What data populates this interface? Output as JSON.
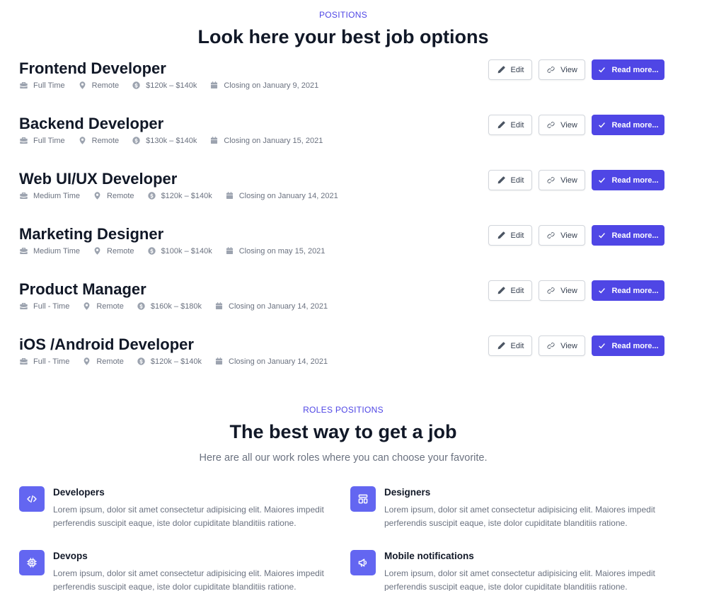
{
  "positions": {
    "eyebrow": "POSITIONS",
    "heading": "Look here your best job options",
    "buttons": {
      "edit": "Edit",
      "view": "View",
      "read_more": "Read more..."
    },
    "jobs": [
      {
        "title": "Frontend Developer",
        "type": "Full Time",
        "location": "Remote",
        "salary": "$120k – $140k",
        "closing": "Closing on January 9, 2021"
      },
      {
        "title": "Backend Developer",
        "type": "Full Time",
        "location": "Remote",
        "salary": "$130k – $140k",
        "closing": "Closing on January 15, 2021"
      },
      {
        "title": "Web UI/UX Developer",
        "type": "Medium Time",
        "location": "Remote",
        "salary": "$120k – $140k",
        "closing": "Closing on January 14, 2021"
      },
      {
        "title": "Marketing Designer",
        "type": "Medium Time",
        "location": "Remote",
        "salary": "$100k – $140k",
        "closing": "Closing on may 15, 2021"
      },
      {
        "title": "Product Manager",
        "type": "Full - Time",
        "location": "Remote",
        "salary": "$160k – $180k",
        "closing": "Closing on January 14, 2021"
      },
      {
        "title": "iOS /Android Developer",
        "type": "Full - Time",
        "location": "Remote",
        "salary": "$120k – $140k",
        "closing": "Closing on January 14, 2021"
      }
    ]
  },
  "roles": {
    "eyebrow": "ROLES POSITIONS",
    "heading": "The best way to get a job",
    "subtitle": "Here are all our work roles where you can choose your favorite.",
    "items": [
      {
        "title": "Developers",
        "icon": "code-icon",
        "description": "Lorem ipsum, dolor sit amet consectetur adipisicing elit. Maiores impedit perferendis suscipit eaque, iste dolor cupiditate blanditiis ratione."
      },
      {
        "title": "Designers",
        "icon": "layout-icon",
        "description": "Lorem ipsum, dolor sit amet consectetur adipisicing elit. Maiores impedit perferendis suscipit eaque, iste dolor cupiditate blanditiis ratione."
      },
      {
        "title": "Devops",
        "icon": "chip-icon",
        "description": "Lorem ipsum, dolor sit amet consectetur adipisicing elit. Maiores impedit perferendis suscipit eaque, iste dolor cupiditate blanditiis ratione."
      },
      {
        "title": "Mobile notifications",
        "icon": "megaphone-icon",
        "description": "Lorem ipsum, dolor sit amet consectetur adipisicing elit. Maiores impedit perferendis suscipit eaque, iste dolor cupiditate blanditiis ratione."
      }
    ]
  },
  "colors": {
    "accent": "#4f46e5",
    "icon_bg": "#6366f1",
    "muted": "#6b7280",
    "heading": "#111827"
  }
}
